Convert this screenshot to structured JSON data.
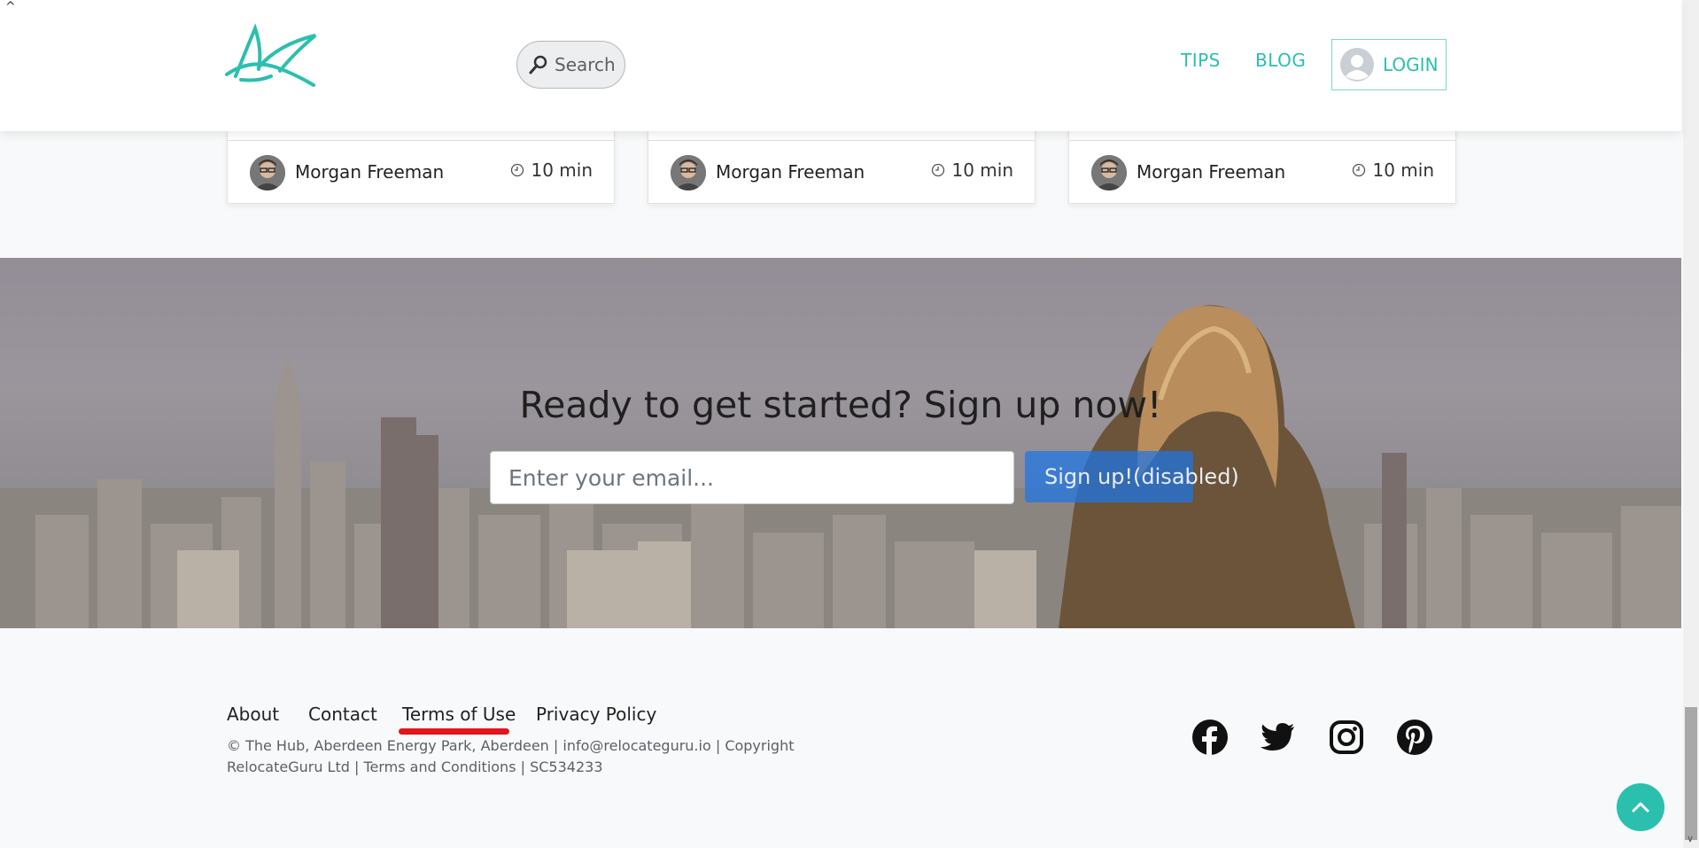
{
  "header": {
    "search_placeholder": "Search",
    "nav": {
      "tips": "TIPS",
      "blog": "BLOG",
      "login": "LOGIN"
    }
  },
  "cards": [
    {
      "author": "Morgan Freeman",
      "time": "10 min"
    },
    {
      "author": "Morgan Freeman",
      "time": "10 min"
    },
    {
      "author": "Morgan Freeman",
      "time": "10 min"
    }
  ],
  "hero": {
    "title": "Ready to get started? Sign up now!",
    "email_placeholder": "Enter your email...",
    "signup_label": "Sign up!(disabled)"
  },
  "footer": {
    "links": {
      "about": "About",
      "contact": "Contact",
      "terms": "Terms of Use",
      "privacy": "Privacy Policy"
    },
    "address": "© The Hub, Aberdeen Energy Park, Aberdeen | info@relocateguru.io | Copyright RelocateGuru Ltd | Terms and Conditions | SC534233",
    "social_icons": [
      "facebook-icon",
      "twitter-icon",
      "instagram-icon",
      "pinterest-icon"
    ]
  },
  "colors": {
    "accent": "#2bbfae",
    "signup_button": "#1c76e6",
    "annotation_underline": "#e0161c"
  }
}
